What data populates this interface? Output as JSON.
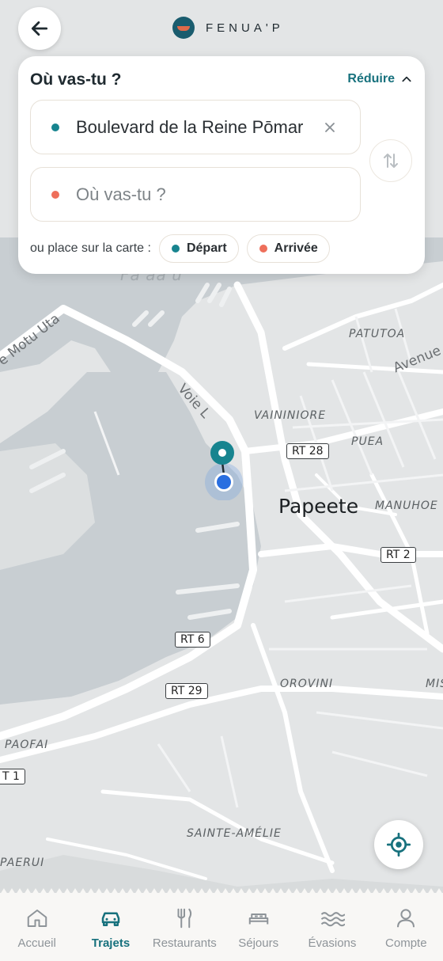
{
  "header": {
    "brand_name": "FENUA'P",
    "back_icon": "arrow-left-icon"
  },
  "search": {
    "title": "Où vas-tu ?",
    "reduce_label": "Réduire",
    "origin_value": "Boulevard de la Reine Pōmar",
    "destination_placeholder": "Où vas-tu ?",
    "place_on_map_label": "ou place sur la carte :",
    "departure_chip": "Départ",
    "arrival_chip": "Arrivée",
    "colors": {
      "teal": "#17848f",
      "coral": "#ee6f5b"
    }
  },
  "map": {
    "labels": {
      "papeete": "Papeete",
      "patutoa": "PATUTOA",
      "vaininiore": "VAININIORE",
      "puea": "PUEA",
      "manuhoe": "MANUHOE",
      "orovini": "OROVINI",
      "mis": "MIS",
      "paofai": "PAOFAI",
      "sainte_amelie": "SAINTE-AMÉLIE",
      "paerui": "PAERUI",
      "fare_ute": "Fa'aa'u"
    },
    "streets": {
      "motu_uta": "e Motu Uta",
      "voie": "Voie L",
      "avenue": "Avenue"
    },
    "shields": {
      "rt28": "RT 28",
      "rt2": "RT 2",
      "rt6": "RT 6",
      "rt29": "RT 29",
      "rt1": "T 1"
    }
  },
  "nav": {
    "items": [
      {
        "label": "Accueil",
        "icon": "home-icon"
      },
      {
        "label": "Trajets",
        "icon": "car-icon",
        "active": true
      },
      {
        "label": "Restaurants",
        "icon": "fork-knife-icon"
      },
      {
        "label": "Séjours",
        "icon": "bed-icon"
      },
      {
        "label": "Évasions",
        "icon": "waves-icon"
      },
      {
        "label": "Compte",
        "icon": "user-icon"
      }
    ]
  }
}
